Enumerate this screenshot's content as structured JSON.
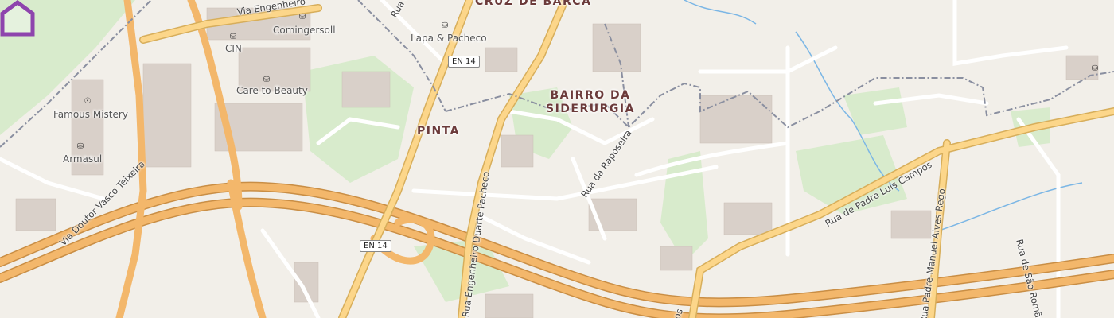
{
  "map": {
    "colors": {
      "background": "#f2efe9",
      "park": "#d8ebcc",
      "motorway": "#f3b76b",
      "primary": "#fcd68a",
      "minor_road": "#ffffff",
      "building": "#d9d0c9",
      "boundary": "#8a8fa0",
      "water": "#7bb6e5",
      "marker": "#8e44ad"
    },
    "areas": {
      "cruz_de_barca": "CRUZ DE BARCA",
      "pinta": "PINTA",
      "bairro_line1": "BAIRRO DA",
      "bairro_line2": "SIDERURGIA"
    },
    "pois": {
      "comingersoll": "Comingersoll",
      "cin": "CIN",
      "care_to_beauty": "Care to Beauty",
      "famous_mistery": "Famous Mistery",
      "armasul": "Armasul",
      "lapa_pacheco": "Lapa & Pacheco"
    },
    "roads": {
      "via_engenheiro": "Via Engenheiro",
      "rua_top": "Rua d",
      "via_doutor_vasco": "Via Doutor Vasco Teixeira",
      "rua_eng_duarte": "Rua Engenheiro Duarte Pacheco",
      "rua_raposeira": "Rua da Raposeira",
      "rua_padre_luis": "Rua de Padre Luís Campos",
      "rua_padre_manuel": "Rua Padre Manuel Alves Rego",
      "rua_sao_romao": "Rua de São Romão",
      "bottom_fragment": "os"
    },
    "shields": {
      "en14_top": "EN 14",
      "en14_bottom": "EN 14"
    },
    "icons": {
      "shop": "shop-icon",
      "clothes": "clothes-icon",
      "home_marker": "home-marker-icon"
    }
  }
}
